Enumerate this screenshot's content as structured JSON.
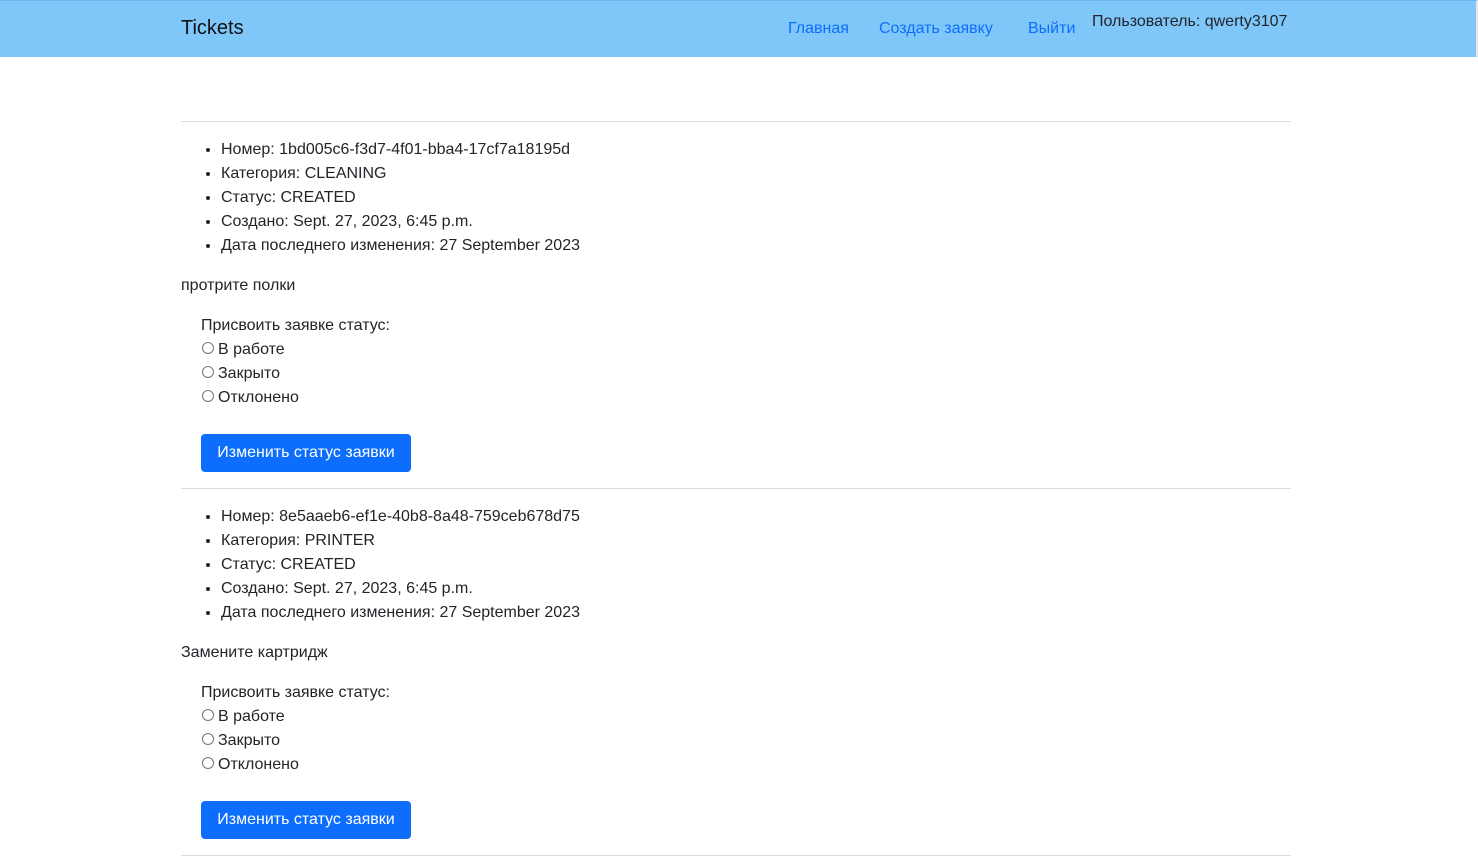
{
  "nav": {
    "brand": "Tickets",
    "links": [
      "Главная",
      "Создать заявку",
      "Выйти"
    ],
    "user": "Пользователь: qwerty3107"
  },
  "tickets": [
    {
      "number": "Номер: 1bd005c6-f3d7-4f01-bba4-17cf7a18195d",
      "category": "Категория: CLEANING",
      "status": "Статус: CREATED",
      "created": "Создано: Sept. 27, 2023, 6:45 p.m.",
      "modified": "Дата последнего изменения: 27 September 2023",
      "description": "протрите полки",
      "status_prompt": "Присвоить заявке статус:",
      "options": [
        "В работе",
        "Закрыто",
        "Отклонено"
      ],
      "button": "Изменить статус заявки"
    },
    {
      "number": "Номер: 8e5aaeb6-ef1e-40b8-8a48-759ceb678d75",
      "category": "Категория: PRINTER",
      "status": "Статус: CREATED",
      "created": "Создано: Sept. 27, 2023, 6:45 p.m.",
      "modified": "Дата последнего изменения: 27 September 2023",
      "description": "Замените картридж",
      "status_prompt": "Присвоить заявке статус:",
      "options": [
        "В работе",
        "Закрыто",
        "Отклонено"
      ],
      "button": "Изменить статус заявки"
    }
  ],
  "colors": {
    "navbar": "#80c7f9",
    "link": "#0d6efd",
    "button": "#0d6efd"
  }
}
